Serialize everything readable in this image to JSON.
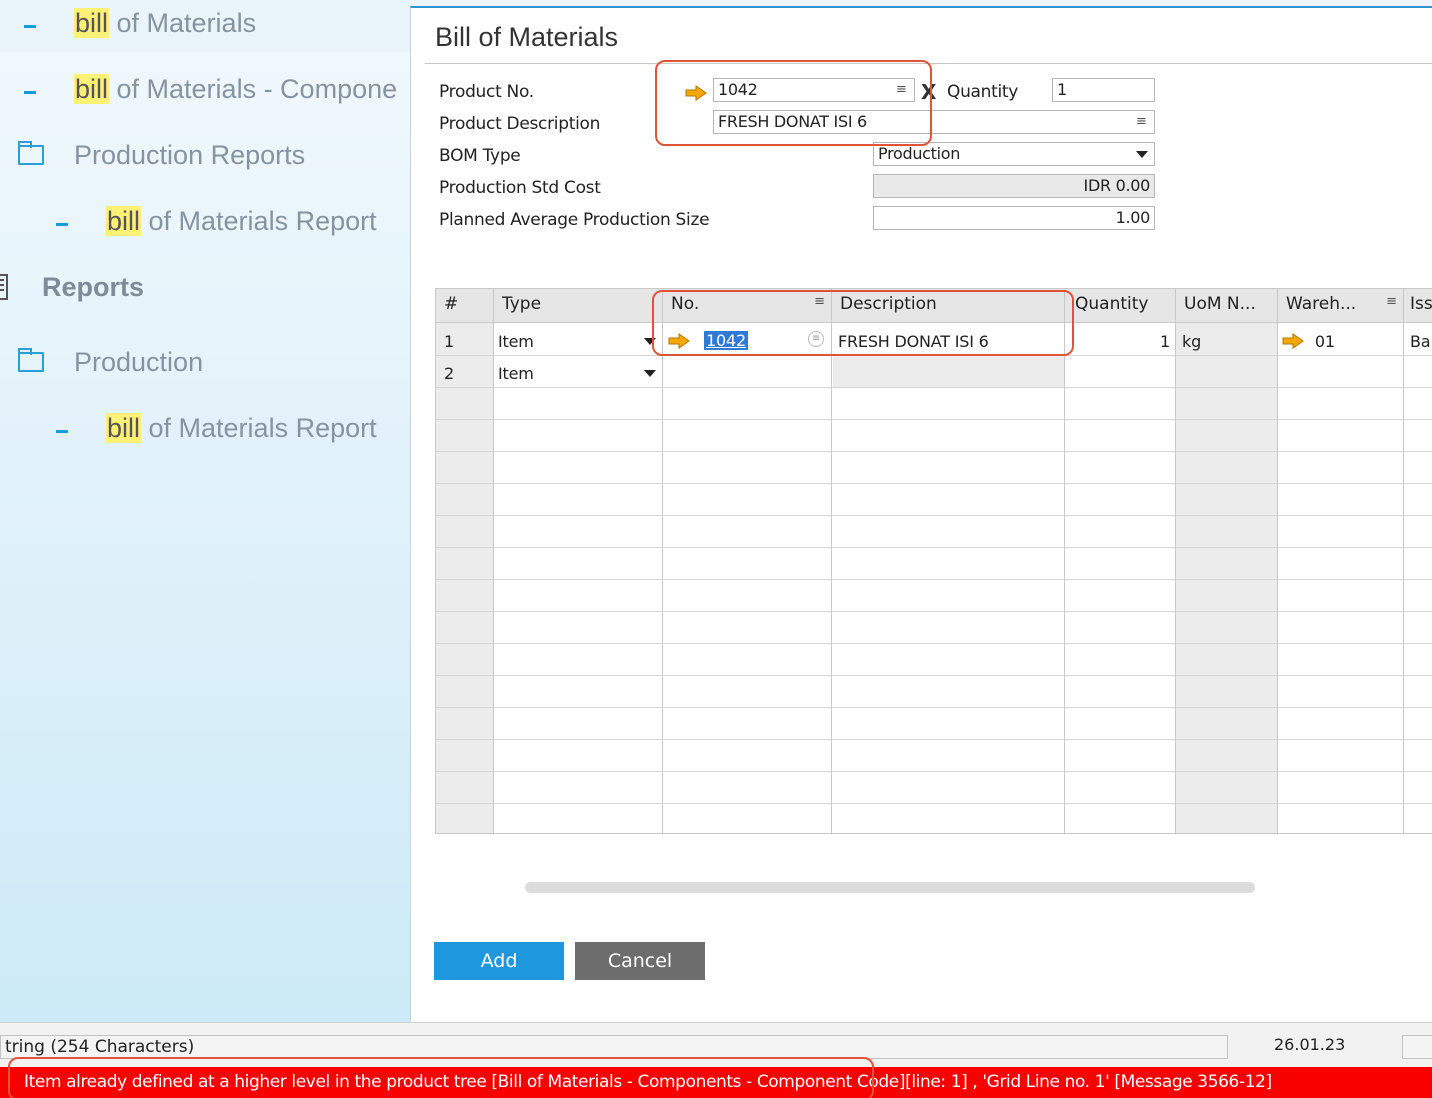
{
  "nav": {
    "items": [
      {
        "highlight": "bill",
        "rest": " of Materials"
      },
      {
        "highlight": "bill",
        "rest": " of Materials - Compone"
      },
      {
        "label": "Production Reports"
      },
      {
        "highlight": "bill",
        "rest": " of Materials Report"
      },
      {
        "label": "Reports"
      },
      {
        "label": "Production"
      },
      {
        "highlight": "bill",
        "rest": " of Materials Report"
      }
    ]
  },
  "window": {
    "title": "Bill of Materials",
    "fields": {
      "product_no_label": "Product No.",
      "product_no": "1042",
      "quantity_label": "Quantity",
      "quantity": "1",
      "product_desc_label": "Product Description",
      "product_desc": "FRESH DONAT ISI 6",
      "bom_type_label": "BOM Type",
      "bom_type": "Production",
      "std_cost_label": "Production Std Cost",
      "std_cost": "IDR 0.00",
      "planned_size_label": "Planned Average Production Size",
      "planned_size": "1.00"
    },
    "grid": {
      "headers": [
        "#",
        "Type",
        "No.",
        "Description",
        "Quantity",
        "UoM N...",
        "Wareh...",
        "Iss"
      ],
      "rows": [
        {
          "num": "1",
          "type": "Item",
          "no": "1042",
          "description": "FRESH DONAT ISI 6",
          "quantity": "1",
          "uom": "kg",
          "warehouse": "01",
          "issue": "Ba"
        },
        {
          "num": "2",
          "type": "Item",
          "no": "",
          "description": "",
          "quantity": "",
          "uom": "",
          "warehouse": "",
          "issue": ""
        }
      ]
    },
    "buttons": {
      "add": "Add",
      "cancel": "Cancel"
    }
  },
  "statusbar": {
    "field_text": "tring (254 Characters)",
    "date": "26.01.23",
    "error": "Item already defined at a higher level in the product tree [Bill of Materials - Components - Component Code][line: 1] , 'Grid Line no. 1'  [Message 3566-12]"
  },
  "colors": {
    "accent": "#1e97de",
    "error": "#f80000",
    "annotation": "#e0533b",
    "highlight": "#fff176"
  }
}
